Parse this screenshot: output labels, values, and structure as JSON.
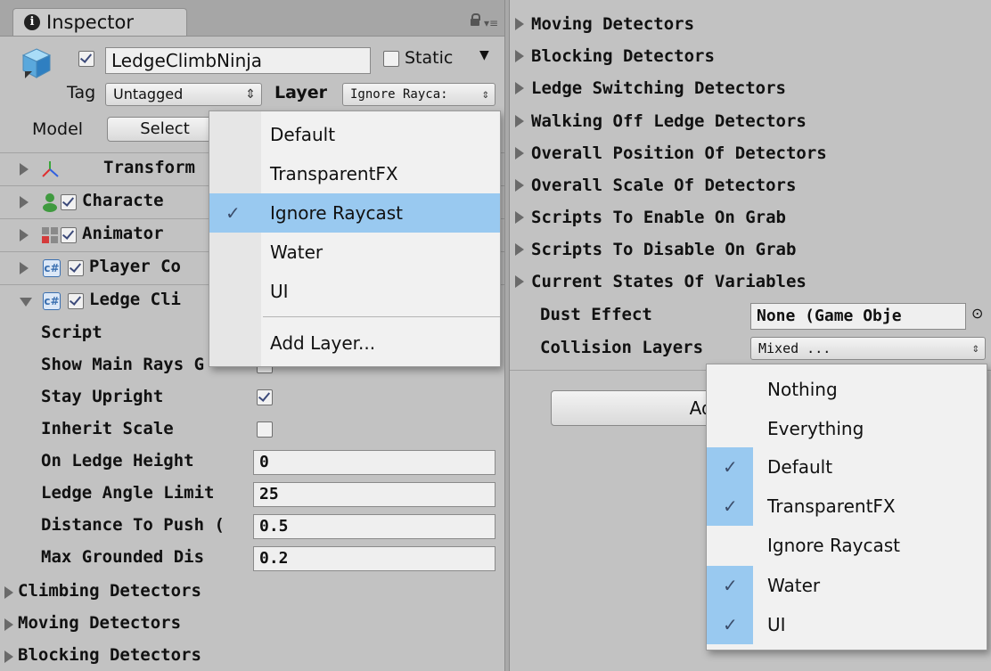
{
  "inspector": {
    "tab_title": "Inspector",
    "object_name": "LedgeClimbNinja",
    "static_label": "Static",
    "tag_label": "Tag",
    "tag_value": "Untagged",
    "layer_label": "Layer",
    "layer_value": "Ignore Rayca:",
    "model_label": "Model",
    "select_button": "Select"
  },
  "components": [
    {
      "name": "Transform"
    },
    {
      "name": "Characte"
    },
    {
      "name": "Animator"
    },
    {
      "name": "Player Co"
    },
    {
      "name": "Ledge Cli"
    }
  ],
  "properties": {
    "script": "Script",
    "show_main_rays": "Show Main Rays G",
    "stay_upright": "Stay Upright",
    "inherit_scale": "Inherit Scale",
    "on_ledge_height": "On Ledge Height",
    "on_ledge_height_value": "0",
    "ledge_angle_limit": "Ledge Angle Limit",
    "ledge_angle_limit_value": "25",
    "distance_to_push": "Distance To Push (",
    "distance_to_push_value": "0.5",
    "max_grounded_dis": "Max Grounded Dis",
    "max_grounded_dis_value": "0.2"
  },
  "left_foldouts": [
    "Climbing Detectors",
    "Moving Detectors",
    "Blocking Detectors"
  ],
  "layer_menu": {
    "items": [
      "Default",
      "TransparentFX",
      "Ignore Raycast",
      "Water",
      "UI"
    ],
    "selected": "Ignore Raycast",
    "add_layer": "Add Layer..."
  },
  "right_foldouts": [
    "Moving Detectors",
    "Blocking Detectors",
    "Ledge Switching Detectors",
    "Walking Off Ledge Detectors",
    "Overall Position Of Detectors",
    "Overall Scale Of Detectors",
    "Scripts To Enable On Grab",
    "Scripts To Disable On Grab",
    "Current States Of Variables"
  ],
  "right_fields": {
    "dust_effect_label": "Dust Effect",
    "dust_effect_value": "None (Game Obje",
    "collision_layers_label": "Collision Layers",
    "collision_layers_value": "Mixed ...",
    "add_component_button": "Add"
  },
  "collision_menu": {
    "items": [
      "Nothing",
      "Everything",
      "Default",
      "TransparentFX",
      "Ignore Raycast",
      "Water",
      "UI"
    ],
    "checked": [
      false,
      false,
      true,
      true,
      false,
      true,
      true
    ]
  },
  "colors": {
    "panel_bg": "#c2c2c2",
    "menu_highlight": "#99c9f0",
    "menu_bg": "#f1f1f1"
  }
}
